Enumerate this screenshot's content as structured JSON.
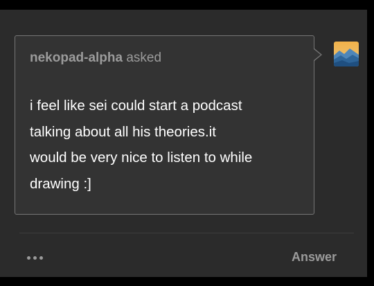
{
  "ask": {
    "asker_name": "nekopad-alpha",
    "asked_label": "asked",
    "question_lines": [
      "i feel like sei could start a podcast",
      "talking about all his theories.it",
      "would be very nice to listen to while",
      "drawing :]"
    ]
  },
  "avatar": {
    "icon": "landscape-avatar-icon",
    "colors": {
      "sky_top": "#f2b24a",
      "sky_bottom": "#e8c37a",
      "mountain_back": "#4f86b8",
      "mountain_front": "#1f4f80"
    }
  },
  "footer": {
    "more_icon": "ellipsis-icon",
    "answer_label": "Answer"
  },
  "colors": {
    "background": "#000000",
    "panel": "#2b2b2b",
    "card": "#333333",
    "card_border": "#767676",
    "text_primary": "#ffffff",
    "text_muted": "#9b9b9b"
  }
}
